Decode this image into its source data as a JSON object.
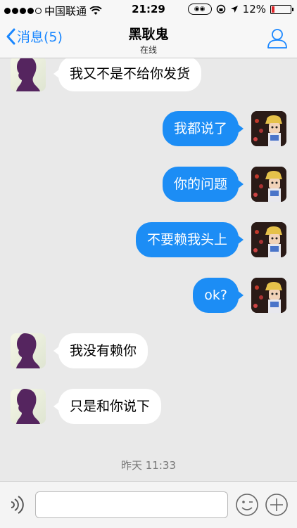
{
  "status_bar": {
    "carrier": "中国联通",
    "time": "21:29",
    "battery": "12%",
    "signal_icon": "signal-dots-icon",
    "wifi_icon": "wifi-icon"
  },
  "nav": {
    "back_label": "消息(5)",
    "title": "黑耿鬼",
    "subtitle": "在线"
  },
  "messages": [
    {
      "side": "left",
      "text": "我又不是不给你发货"
    },
    {
      "side": "right",
      "text": "我都说了"
    },
    {
      "side": "right",
      "text": "你的问题"
    },
    {
      "side": "right",
      "text": "不要赖我头上"
    },
    {
      "side": "right",
      "text": "ok?"
    },
    {
      "side": "left",
      "text": "我没有赖你"
    },
    {
      "side": "left",
      "text": "只是和你说下"
    }
  ],
  "timestamp": "昨天 11:33",
  "input": {
    "placeholder": "",
    "voice_icon": "voice-icon",
    "emoji_icon": "emoji-icon",
    "plus_icon": "plus-icon"
  },
  "colors": {
    "accent": "#1a87ff",
    "outgoing_bubble": "#1c8df5",
    "incoming_bubble": "#ffffff",
    "chat_background": "#e9e9e9"
  }
}
